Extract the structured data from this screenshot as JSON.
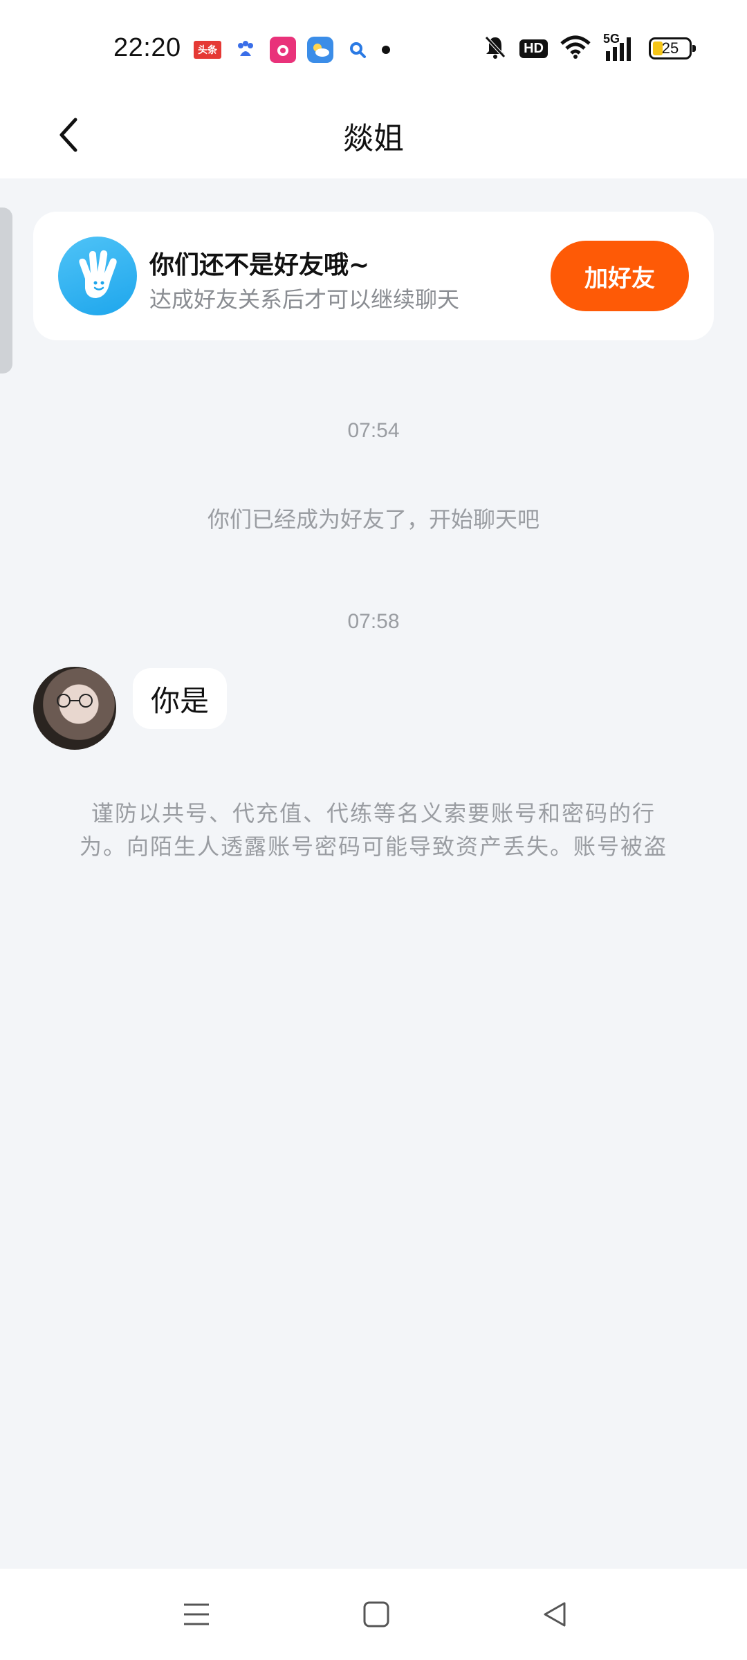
{
  "status_bar": {
    "time": "22:20",
    "notification_icons": [
      "toutiao-icon",
      "baidu-icon",
      "pinduoduo-icon",
      "weather-icon",
      "search-app-icon",
      "more-dot-icon"
    ],
    "toutiao_label": "头条",
    "network": "5G",
    "hd_label": "HD",
    "battery": "25"
  },
  "header": {
    "title": "燚姐"
  },
  "friend_card": {
    "title": "你们还不是好友哦~",
    "subtitle": "达成好友关系后才可以继续聊天",
    "button_label": "加好友"
  },
  "chat": {
    "time_1": "07:54",
    "system_message": "你们已经成为好友了，开始聊天吧",
    "time_2": "07:58",
    "message_text": "你是",
    "warning_line_1": "谨防以共号、代充值、代练等名义索要账号和密码的行",
    "warning_line_2": "为。向陌生人透露账号密码可能导致资产丢失。账号被盗"
  },
  "colors": {
    "accent": "#fe5a06",
    "background": "#f3f5f8",
    "muted_text": "#9a9da2"
  },
  "nav_bar": {
    "icons": [
      "menu-icon",
      "home-square-icon",
      "back-triangle-icon"
    ]
  }
}
